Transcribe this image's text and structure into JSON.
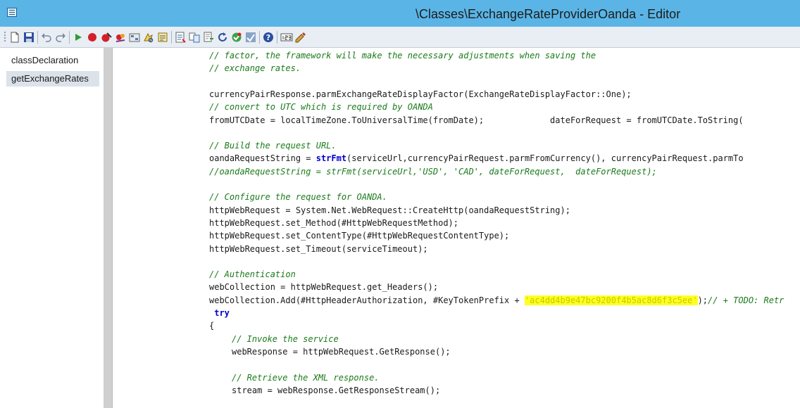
{
  "window": {
    "title": "\\Classes\\ExchangeRateProviderOanda - Editor"
  },
  "toolbar": {
    "buttons": [
      {
        "icon": "new-icon"
      },
      {
        "icon": "save-icon"
      },
      {
        "icon": "undo-icon"
      },
      {
        "icon": "redo-icon"
      },
      {
        "icon": "run-icon"
      },
      {
        "icon": "breakpoint-icon"
      },
      {
        "icon": "remove-breakpoint-icon"
      },
      {
        "icon": "disable-breakpoint-icon"
      },
      {
        "icon": "compile-icon"
      },
      {
        "icon": "lookup-icon"
      },
      {
        "icon": "properties-icon"
      },
      {
        "icon": "script-icon"
      },
      {
        "icon": "source-control-icon"
      },
      {
        "icon": "history-icon"
      },
      {
        "icon": "refresh-icon"
      },
      {
        "icon": "best-practice-icon"
      },
      {
        "icon": "help-icon"
      },
      {
        "icon": "line-numbers-icon"
      },
      {
        "icon": "pencil-icon"
      }
    ]
  },
  "methods": [
    {
      "label": "classDeclaration",
      "selected": false
    },
    {
      "label": "getExchangeRates",
      "selected": true
    }
  ],
  "code": {
    "lines": [
      {
        "indent": 0,
        "parts": [
          {
            "text": "// factor, the framework will make the necessary adjustments when saving the",
            "style": "comment"
          }
        ]
      },
      {
        "indent": 0,
        "parts": [
          {
            "text": "// exchange rates.",
            "style": "comment"
          }
        ]
      },
      {
        "indent": 0,
        "parts": []
      },
      {
        "indent": 0,
        "parts": [
          {
            "text": "currencyPairResponse.parmExchangeRateDisplayFactor(ExchangeRateDisplayFactor::One);",
            "style": "normal"
          }
        ]
      },
      {
        "indent": 0,
        "parts": [
          {
            "text": "// convert to UTC which is required by OANDA",
            "style": "comment"
          }
        ]
      },
      {
        "indent": 0,
        "parts": [
          {
            "text": "fromUTCDate = localTimeZone.ToUniversalTime(fromDate);             dateForRequest = fromUTCDate.ToString(",
            "style": "normal"
          }
        ]
      },
      {
        "indent": 0,
        "parts": []
      },
      {
        "indent": 0,
        "parts": [
          {
            "text": "// Build the request URL.",
            "style": "comment"
          }
        ]
      },
      {
        "indent": 0,
        "parts": [
          {
            "text": "oandaRequestString = ",
            "style": "normal"
          },
          {
            "text": "strFmt",
            "style": "keyword"
          },
          {
            "text": "(serviceUrl,currencyPairRequest.parmFromCurrency(), currencyPairRequest.parmTo",
            "style": "normal"
          }
        ]
      },
      {
        "indent": 0,
        "parts": [
          {
            "text": "//oandaRequestString = strFmt(serviceUrl,'USD', 'CAD', dateForRequest,  dateForRequest);",
            "style": "comment"
          }
        ]
      },
      {
        "indent": 0,
        "parts": []
      },
      {
        "indent": 0,
        "parts": [
          {
            "text": "// Configure the request for OANDA.",
            "style": "comment"
          }
        ]
      },
      {
        "indent": 0,
        "parts": [
          {
            "text": "httpWebRequest = System.Net.WebRequest::CreateHttp(oandaRequestString);",
            "style": "normal"
          }
        ]
      },
      {
        "indent": 0,
        "parts": [
          {
            "text": "httpWebRequest.set_Method(#HttpWebRequestMethod);",
            "style": "normal"
          }
        ]
      },
      {
        "indent": 0,
        "parts": [
          {
            "text": "httpWebRequest.set_ContentType(#HttpWebRequestContentType);",
            "style": "normal"
          }
        ]
      },
      {
        "indent": 0,
        "parts": [
          {
            "text": "httpWebRequest.set_Timeout(serviceTimeout);",
            "style": "normal"
          }
        ]
      },
      {
        "indent": 0,
        "parts": []
      },
      {
        "indent": 0,
        "parts": [
          {
            "text": "// Authentication",
            "style": "comment"
          }
        ]
      },
      {
        "indent": 0,
        "parts": [
          {
            "text": "webCollection = httpWebRequest.get_Headers();",
            "style": "normal"
          }
        ]
      },
      {
        "indent": 0,
        "parts": [
          {
            "text": "webCollection.Add(#HttpHeaderAuthorization, #KeyTokenPrefix + ",
            "style": "normal"
          },
          {
            "text": "'ac4dd4b9e47bc9200f4b5ac8d6f3c5ee'",
            "style": "redacted"
          },
          {
            "text": ");",
            "style": "normal"
          },
          {
            "text": "// + TODO: Retr",
            "style": "comment"
          }
        ]
      },
      {
        "indent": 0,
        "parts": [
          {
            "text": " try",
            "style": "keyword"
          }
        ]
      },
      {
        "indent": 0,
        "parts": [
          {
            "text": "{",
            "style": "normal"
          }
        ]
      },
      {
        "indent": 1,
        "parts": [
          {
            "text": "// Invoke the service",
            "style": "comment"
          }
        ]
      },
      {
        "indent": 1,
        "parts": [
          {
            "text": "webResponse = httpWebRequest.GetResponse();",
            "style": "normal"
          }
        ]
      },
      {
        "indent": 0,
        "parts": []
      },
      {
        "indent": 1,
        "parts": [
          {
            "text": "// Retrieve the XML response.",
            "style": "comment"
          }
        ]
      },
      {
        "indent": 1,
        "parts": [
          {
            "text": "stream = webResponse.GetResponseStream();",
            "style": "normal"
          }
        ]
      }
    ]
  }
}
